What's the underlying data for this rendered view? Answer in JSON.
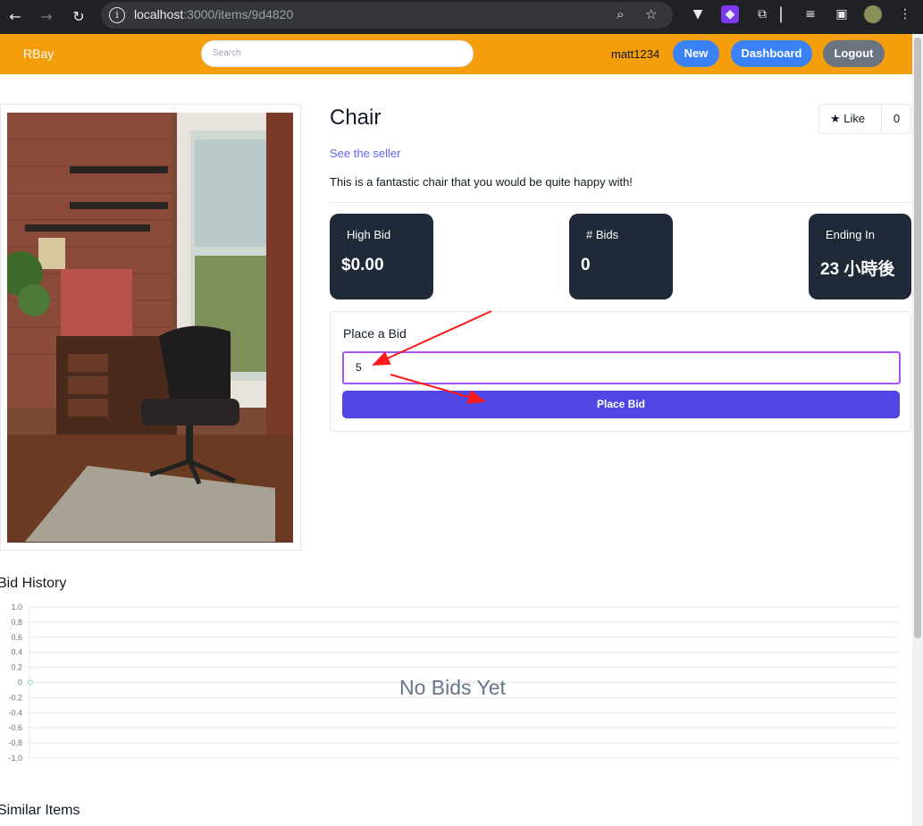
{
  "browser": {
    "url_host": "localhost",
    "url_path": ":3000/items/9d4820"
  },
  "header": {
    "brand": "RBay",
    "search_placeholder": "Search",
    "username": "matt1234",
    "buttons": {
      "new": "New",
      "dashboard": "Dashboard",
      "logout": "Logout"
    },
    "colors": {
      "bar": "#f59e0b",
      "primary": "#3b82f6",
      "logout": "#6b7280"
    }
  },
  "item": {
    "title": "Chair",
    "like_label": "Like",
    "like_count": "0",
    "seller_link": "See the seller",
    "description": "This is a fantastic chair that you would be quite happy with!"
  },
  "stats": [
    {
      "label": "High Bid",
      "value": "$0.00"
    },
    {
      "label": "# Bids",
      "value": "0"
    },
    {
      "label": "Ending In",
      "value": "23 小時後"
    }
  ],
  "bid": {
    "heading": "Place a Bid",
    "input_value": "5",
    "button_label": "Place Bid"
  },
  "bid_history": {
    "heading": "Bid History",
    "empty_message": "No Bids Yet"
  },
  "similar_items": {
    "heading": "Similar Items"
  },
  "chart_data": {
    "type": "line",
    "title": "",
    "xlabel": "",
    "ylabel": "",
    "ylim": [
      -1.0,
      1.0
    ],
    "y_ticks": [
      "1.0",
      "0.8",
      "0.6",
      "0.4",
      "0.2",
      "0",
      "-0.2",
      "-0.4",
      "-0.6",
      "-0.8",
      "-1.0"
    ],
    "series": [
      {
        "values": [
          0
        ]
      }
    ],
    "grid": true
  }
}
